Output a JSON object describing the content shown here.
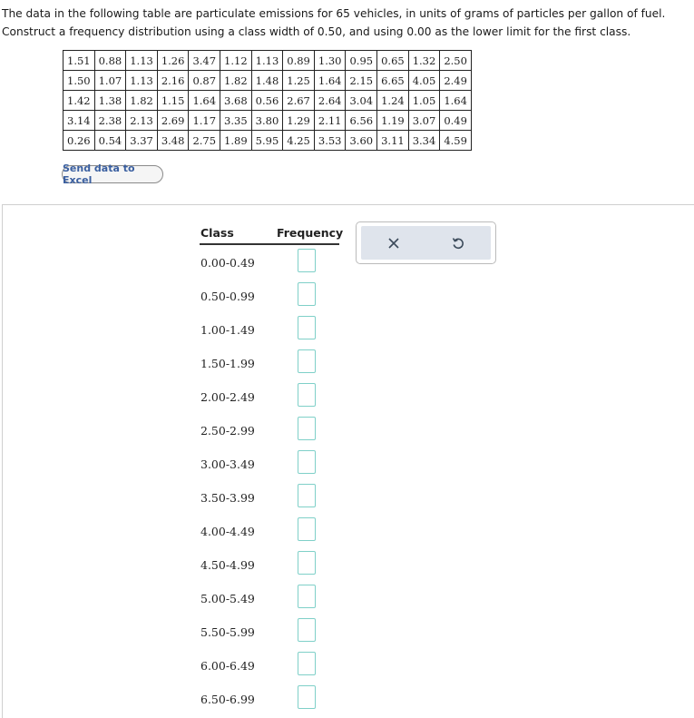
{
  "prompt": {
    "text": "The data in the following table are particulate emissions for 65 vehicles, in units of grams of particles per gallon of fuel. Construct a frequency distribution using a class width of 0.50, and using 0.00 as the lower limit for the first class."
  },
  "data_table": {
    "rows": [
      [
        "1.51",
        "0.88",
        "1.13",
        "1.26",
        "3.47",
        "1.12",
        "1.13",
        "0.89",
        "1.30",
        "0.95",
        "0.65",
        "1.32",
        "2.50"
      ],
      [
        "1.50",
        "1.07",
        "1.13",
        "2.16",
        "0.87",
        "1.82",
        "1.48",
        "1.25",
        "1.64",
        "2.15",
        "6.65",
        "4.05",
        "2.49"
      ],
      [
        "1.42",
        "1.38",
        "1.82",
        "1.15",
        "1.64",
        "3.68",
        "0.56",
        "2.67",
        "2.64",
        "3.04",
        "1.24",
        "1.05",
        "1.64"
      ],
      [
        "3.14",
        "2.38",
        "2.13",
        "2.69",
        "1.17",
        "3.35",
        "3.80",
        "1.29",
        "2.11",
        "6.56",
        "1.19",
        "3.07",
        "0.49"
      ],
      [
        "0.26",
        "0.54",
        "3.37",
        "3.48",
        "2.75",
        "1.89",
        "5.95",
        "4.25",
        "3.53",
        "3.60",
        "3.11",
        "3.34",
        "4.59"
      ]
    ]
  },
  "excel_button": {
    "label": "Send data to Excel"
  },
  "frequency_table": {
    "class_header": "Class",
    "frequency_header": "Frequency",
    "classes": [
      "0.00-0.49",
      "0.50-0.99",
      "1.00-1.49",
      "1.50-1.99",
      "2.00-2.49",
      "2.50-2.99",
      "3.00-3.49",
      "3.50-3.99",
      "4.00-4.49",
      "4.50-4.99",
      "5.00-5.49",
      "5.50-5.99",
      "6.00-6.49",
      "6.50-6.99"
    ],
    "frequency_values": [
      "",
      "",
      "",
      "",
      "",
      "",
      "",
      "",
      "",
      "",
      "",
      "",
      "",
      ""
    ]
  },
  "toolbar": {
    "clear_icon": "close-icon",
    "undo_icon": "undo-icon"
  },
  "colors": {
    "input_border": "#7fd0c8",
    "toolbar_bg": "#dfe4ec",
    "link_text": "#3a5fa0"
  }
}
